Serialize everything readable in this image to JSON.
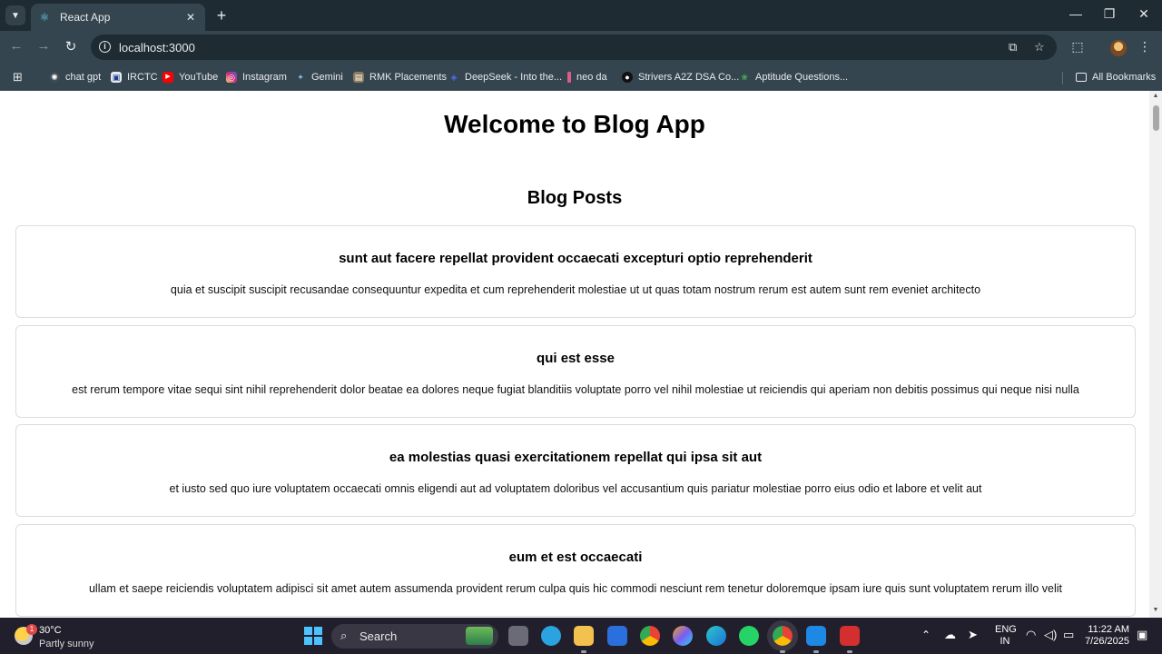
{
  "browser": {
    "tab_title": "React App",
    "url": "localhost:3000",
    "bookmarks": [
      {
        "label": "chat gpt",
        "icon": "chatgpt-icon",
        "color": "#e8eaed"
      },
      {
        "label": "IRCTC",
        "icon": "irctc-icon",
        "color": "#1c3f94"
      },
      {
        "label": "YouTube",
        "icon": "youtube-icon",
        "color": "#ff0000"
      },
      {
        "label": "Instagram",
        "icon": "instagram-icon",
        "color": "#d6249f"
      },
      {
        "label": "Gemini",
        "icon": "gemini-icon",
        "color": "#8ab4f8"
      },
      {
        "label": "RMK Placements",
        "icon": "rmk-icon",
        "color": "#a0a0a0"
      },
      {
        "label": "DeepSeek - Into the...",
        "icon": "deepseek-icon",
        "color": "#4d6bfe"
      },
      {
        "label": "neo da",
        "icon": "neo-icon",
        "color": "#e05a8a"
      },
      {
        "label": "Strivers A2Z DSA Co...",
        "icon": "striver-icon",
        "color": "#111111"
      },
      {
        "label": "Aptitude Questions...",
        "icon": "aptitude-icon",
        "color": "#4caf50"
      }
    ],
    "all_bookmarks": "All Bookmarks"
  },
  "page": {
    "title": "Welcome to Blog App",
    "section_title": "Blog Posts",
    "posts": [
      {
        "title": "sunt aut facere repellat provident occaecati excepturi optio reprehenderit",
        "body": "quia et suscipit suscipit recusandae consequuntur expedita et cum reprehenderit molestiae ut ut quas totam nostrum rerum est autem sunt rem eveniet architecto"
      },
      {
        "title": "qui est esse",
        "body": "est rerum tempore vitae sequi sint nihil reprehenderit dolor beatae ea dolores neque fugiat blanditiis voluptate porro vel nihil molestiae ut reiciendis qui aperiam non debitis possimus qui neque nisi nulla"
      },
      {
        "title": "ea molestias quasi exercitationem repellat qui ipsa sit aut",
        "body": "et iusto sed quo iure voluptatem occaecati omnis eligendi aut ad voluptatem doloribus vel accusantium quis pariatur molestiae porro eius odio et labore et velit aut"
      },
      {
        "title": "eum et est occaecati",
        "body": "ullam et saepe reiciendis voluptatem adipisci sit amet autem assumenda provident rerum culpa quis hic commodi nesciunt rem tenetur doloremque ipsam iure quis sunt voluptatem rerum illo velit"
      }
    ]
  },
  "taskbar": {
    "weather_temp": "30°C",
    "weather_condition": "Partly sunny",
    "weather_badge": "1",
    "search_label": "Search",
    "lang_top": "ENG",
    "lang_bottom": "IN",
    "time": "11:22 AM",
    "date": "7/26/2025"
  }
}
